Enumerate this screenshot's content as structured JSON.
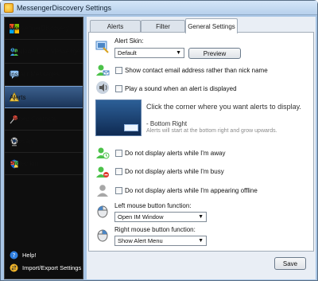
{
  "window": {
    "title": "MessengerDiscovery Settings"
  },
  "sidebar": {
    "items": [
      {
        "label": "MessengerDiscovery"
      },
      {
        "label": "Windows Live Messenger"
      },
      {
        "label": "Instant Messages"
      },
      {
        "label": "Alerts"
      },
      {
        "label": "Pinned Contacts"
      },
      {
        "label": "Webcam"
      },
      {
        "label": "Protection"
      }
    ],
    "bottom": [
      {
        "label": "Help!"
      },
      {
        "label": "Import/Export Settings"
      }
    ]
  },
  "tabs": [
    {
      "label": "Alerts"
    },
    {
      "label": "Filter"
    },
    {
      "label": "General Settings"
    }
  ],
  "settings": {
    "alert_skin_label": "Alert Skin:",
    "alert_skin_value": "Default",
    "preview_label": "Preview",
    "opt_email": "Show contact email address rather than nick name",
    "opt_sound": "Play a sound when an alert is displayed",
    "corner_title": "Click the corner where you want alerts to display.",
    "corner_value": "- Bottom Right",
    "corner_sub": "Alerts will start at the bottom right and grow upwards.",
    "opt_away": "Do not display alerts while I'm away",
    "opt_busy": "Do not display alerts while I'm busy",
    "opt_offline": "Do not display alerts while I'm appearing offline",
    "left_mouse_label": "Left mouse button function:",
    "left_mouse_value": "Open IM Window",
    "right_mouse_label": "Right mouse button function:",
    "right_mouse_value": "Show Alert Menu",
    "save_label": "Save"
  }
}
